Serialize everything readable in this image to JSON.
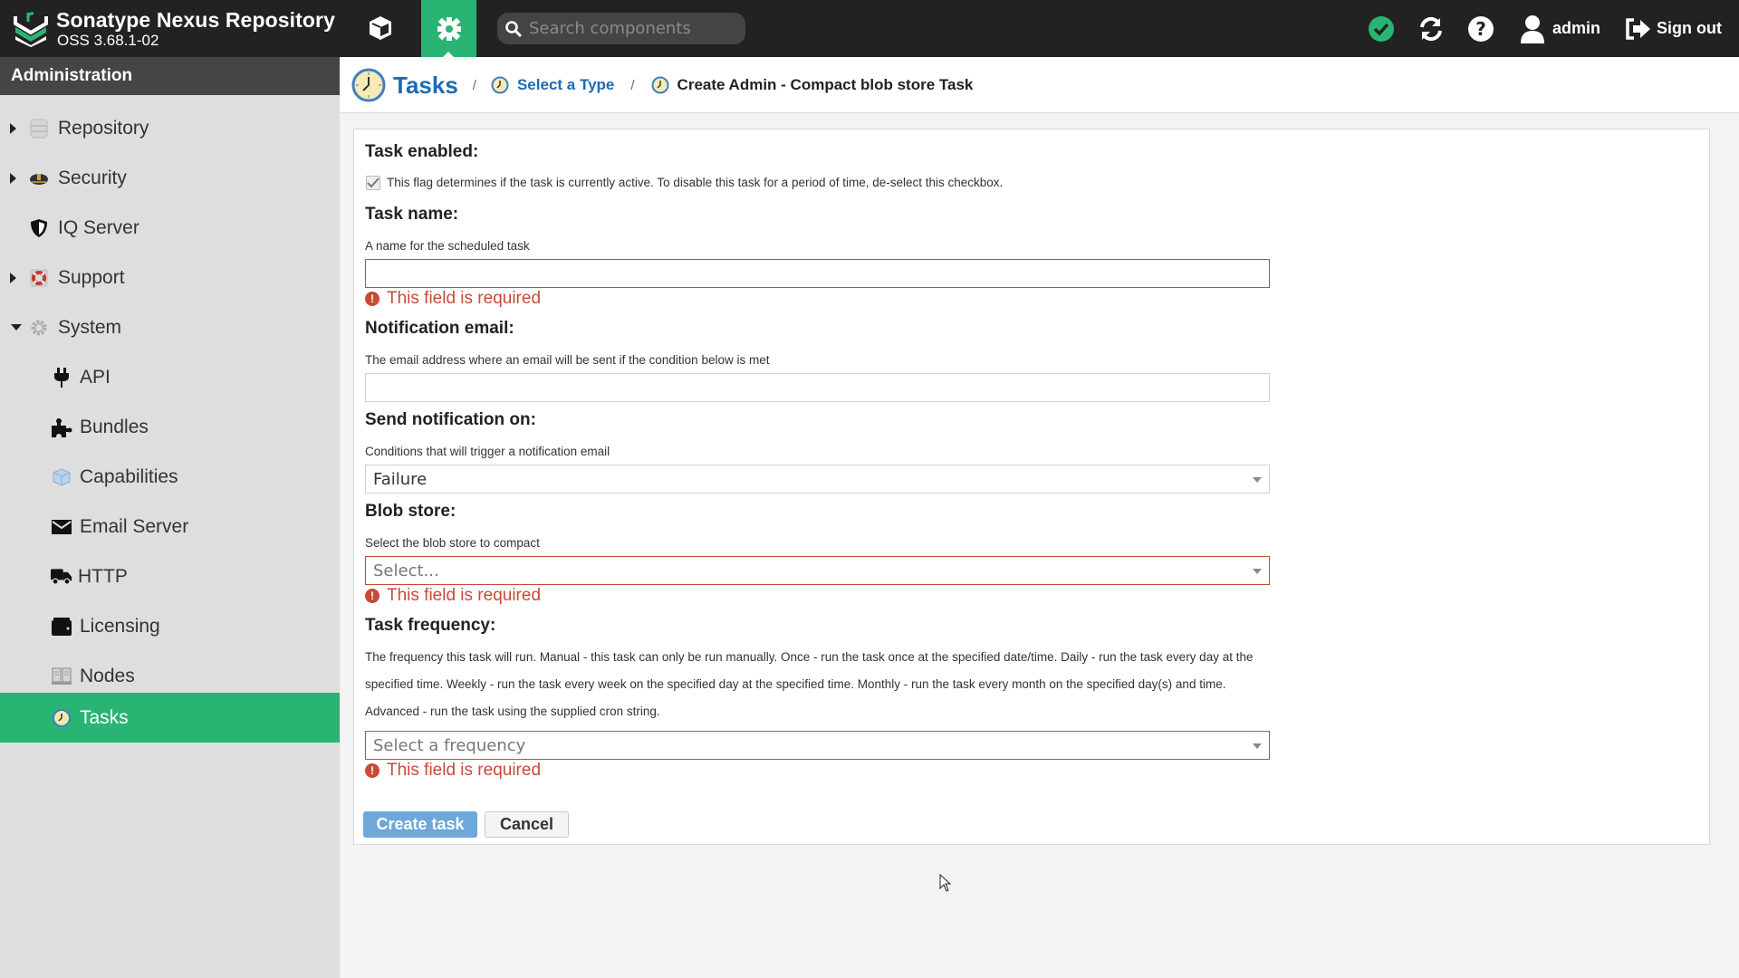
{
  "header": {
    "brand_title": "Sonatype Nexus Repository",
    "brand_version": "OSS 3.68.1-02",
    "search_placeholder": "Search components",
    "user_name": "admin",
    "sign_out_label": "Sign out",
    "colors": {
      "header_bg": "#222222",
      "accent": "#29b473"
    }
  },
  "sidebar": {
    "title": "Administration",
    "items": [
      {
        "label": "Repository",
        "icon": "database-icon",
        "expander": "collapsed",
        "level": 1
      },
      {
        "label": "Security",
        "icon": "security-cap-icon",
        "expander": "collapsed",
        "level": 1
      },
      {
        "label": "IQ Server",
        "icon": "shield-icon",
        "expander": "none",
        "level": 1
      },
      {
        "label": "Support",
        "icon": "lifebuoy-icon",
        "expander": "collapsed",
        "level": 1
      },
      {
        "label": "System",
        "icon": "gear-icon",
        "expander": "expanded",
        "level": 1
      },
      {
        "label": "API",
        "icon": "plug-icon",
        "level": 2
      },
      {
        "label": "Bundles",
        "icon": "puzzle-icon",
        "level": 2
      },
      {
        "label": "Capabilities",
        "icon": "cube-icon",
        "level": 2
      },
      {
        "label": "Email Server",
        "icon": "envelope-icon",
        "level": 2
      },
      {
        "label": "HTTP",
        "icon": "truck-icon",
        "level": 2
      },
      {
        "label": "Licensing",
        "icon": "wallet-icon",
        "level": 2
      },
      {
        "label": "Nodes",
        "icon": "servers-icon",
        "level": 2
      },
      {
        "label": "Tasks",
        "icon": "clock-icon",
        "level": 2,
        "active": true
      }
    ]
  },
  "breadcrumb": {
    "title": "Tasks",
    "separator": "/",
    "link": "Select a Type",
    "current": "Create Admin - Compact blob store Task"
  },
  "form": {
    "task_enabled": {
      "label": "Task enabled:",
      "help": "This flag determines if the task is currently active. To disable this task for a period of time, de-select this checkbox.",
      "checked": true
    },
    "task_name": {
      "label": "Task name:",
      "help": "A name for the scheduled task",
      "value": "",
      "error": "This field is required"
    },
    "notification_email": {
      "label": "Notification email:",
      "help": "The email address where an email will be sent if the condition below is met",
      "value": ""
    },
    "send_notification_on": {
      "label": "Send notification on:",
      "help": "Conditions that will trigger a notification email",
      "selected": "Failure"
    },
    "blob_store": {
      "label": "Blob store:",
      "help": "Select the blob store to compact",
      "placeholder": "Select...",
      "error": "This field is required"
    },
    "task_frequency": {
      "label": "Task frequency:",
      "help": "The frequency this task will run. Manual - this task can only be run manually. Once - run the task once at the specified date/time. Daily - run the task every day at the specified time. Weekly - run the task every week on the specified day at the specified time. Monthly - run the task every month on the specified day(s) and time. Advanced - run the task using the supplied cron string.",
      "placeholder": "Select a frequency",
      "error": "This field is required"
    },
    "buttons": {
      "create": "Create task",
      "cancel": "Cancel"
    },
    "colors": {
      "error": "#c84a38",
      "primary_button": "#6ea7da",
      "link": "#1b6cb5"
    }
  }
}
